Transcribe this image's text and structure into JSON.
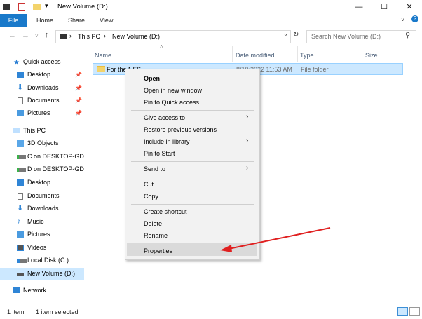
{
  "window": {
    "title": "New Volume (D:)"
  },
  "ribbon": {
    "tabs": [
      "File",
      "Home",
      "Share",
      "View"
    ]
  },
  "address": {
    "segments": [
      "This PC",
      "New Volume (D:)"
    ]
  },
  "search": {
    "placeholder": "Search New Volume (D:)"
  },
  "sidebar": {
    "items": [
      {
        "label": "Quick access"
      },
      {
        "label": "Desktop"
      },
      {
        "label": "Downloads"
      },
      {
        "label": "Documents"
      },
      {
        "label": "Pictures"
      },
      {
        "label": "This PC"
      },
      {
        "label": "3D Objects"
      },
      {
        "label": "C on DESKTOP-GDE"
      },
      {
        "label": "D on DESKTOP-GDE"
      },
      {
        "label": "Desktop"
      },
      {
        "label": "Documents"
      },
      {
        "label": "Downloads"
      },
      {
        "label": "Music"
      },
      {
        "label": "Pictures"
      },
      {
        "label": "Videos"
      },
      {
        "label": "Local Disk (C:)"
      },
      {
        "label": "New Volume (D:)"
      },
      {
        "label": "Network"
      }
    ]
  },
  "columns": {
    "name": "Name",
    "date": "Date modified",
    "type": "Type",
    "size": "Size"
  },
  "files": [
    {
      "name": "For the NFS",
      "date": "8/10/2022 11:53 AM",
      "type": "File folder",
      "size": ""
    }
  ],
  "context_menu": {
    "items": [
      "Open",
      "Open in new window",
      "Pin to Quick access",
      "Give access to",
      "Restore previous versions",
      "Include in library",
      "Pin to Start",
      "Send to",
      "Cut",
      "Copy",
      "Create shortcut",
      "Delete",
      "Rename",
      "Properties"
    ]
  },
  "status": {
    "count": "1 item",
    "selected": "1 item selected"
  },
  "colors": {
    "accent": "#1979ca",
    "selection": "#cce8ff",
    "arrow": "#e02020"
  },
  "icons": [
    "quick-access-star-icon",
    "folder-icon",
    "pc-icon",
    "network-icon",
    "drive-icon",
    "arrow-annotation"
  ]
}
